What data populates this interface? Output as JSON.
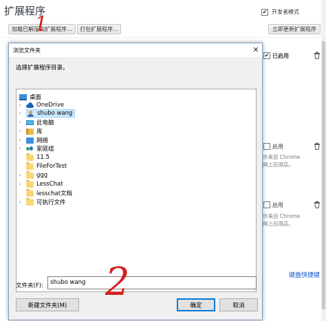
{
  "page": {
    "title": "扩展程序",
    "dev_mode_label": "开发者模式",
    "dev_mode_checked": true,
    "buttons": {
      "load_unpacked": "加载已解压的扩展程序...",
      "pack": "打包扩展程序...",
      "update_now": "立即更新扩展程序"
    },
    "extensions": [
      {
        "status": "已启用",
        "enabled": true,
        "note_line1": "",
        "note_line2": ""
      },
      {
        "status": "启用",
        "enabled": false,
        "note_line1": "许来自 Chrome",
        "note_line2": "网上应用店。"
      },
      {
        "status": "启用",
        "enabled": false,
        "note_line1": "许来自 Chrome",
        "note_line2": "网上应用店。"
      }
    ],
    "shortcut_link": "键盘快捷键"
  },
  "dialog": {
    "title": "浏览文件夹",
    "close_glyph": "✕",
    "prompt": "选择扩展程序目录。",
    "tree": [
      {
        "label": "桌面",
        "icon": "desktop-icon",
        "expandable": false
      },
      {
        "label": "OneDrive",
        "icon": "cloud-icon",
        "expandable": true
      },
      {
        "label": "shubo wang",
        "icon": "user-icon",
        "expandable": true,
        "selected": true
      },
      {
        "label": "此电脑",
        "icon": "computer-icon",
        "expandable": true
      },
      {
        "label": "库",
        "icon": "library-icon",
        "expandable": true
      },
      {
        "label": "网络",
        "icon": "network-icon",
        "expandable": true
      },
      {
        "label": "家庭组",
        "icon": "homegroup-icon",
        "expandable": true
      },
      {
        "label": "11.5",
        "icon": "folder-icon",
        "expandable": false
      },
      {
        "label": "FileForTest",
        "icon": "folder-icon",
        "expandable": false
      },
      {
        "label": "ggg",
        "icon": "folder-icon",
        "expandable": true
      },
      {
        "label": "LessChat",
        "icon": "folder-icon",
        "expandable": true
      },
      {
        "label": "lesschat文档",
        "icon": "folder-icon",
        "expandable": false
      },
      {
        "label": "可执行文件",
        "icon": "folder-icon",
        "expandable": true
      }
    ],
    "folder_label": "文件夹(F):",
    "folder_value": "shubo wang",
    "new_folder_button": "新建文件夹(M)",
    "ok_button": "确定",
    "cancel_button": "取消"
  },
  "annotations": {
    "mark1": "1",
    "mark2": "2",
    "color": "#d42020"
  }
}
